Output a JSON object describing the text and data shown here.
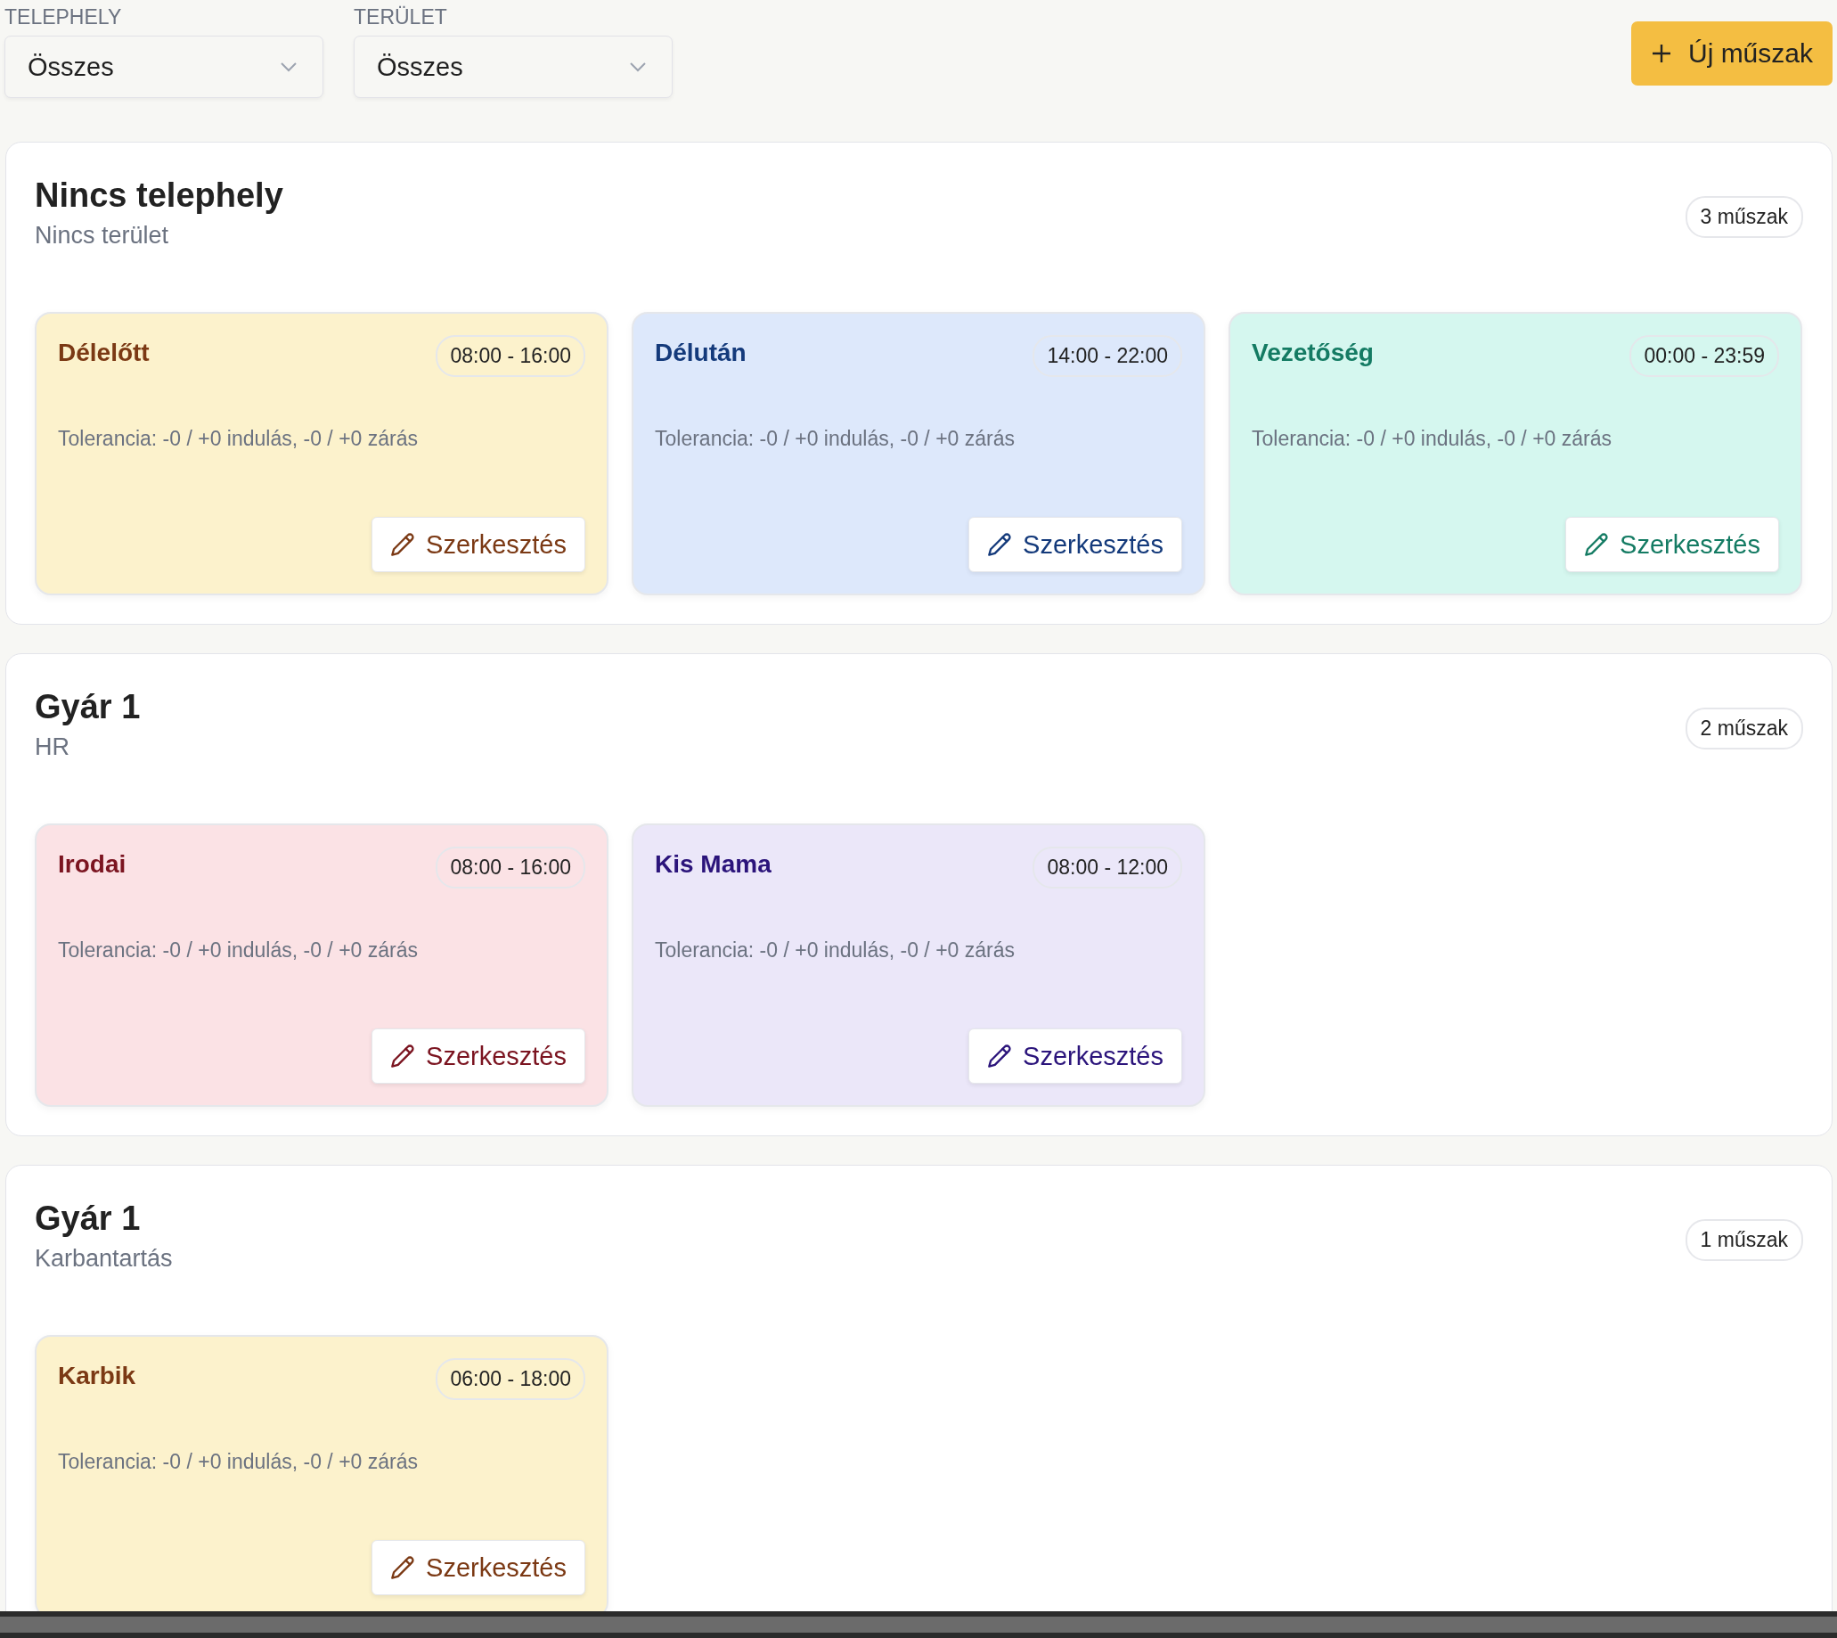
{
  "filters": [
    {
      "label": "TELEPHELY",
      "value": "Összes"
    },
    {
      "label": "TERÜLET",
      "value": "Összes"
    }
  ],
  "new_button": {
    "label": "Új műszak"
  },
  "groups": [
    {
      "site": "Nincs telephely",
      "area": "Nincs terület",
      "count": "3 műszak",
      "shifts": [
        {
          "name": "Délelőtt",
          "time": "08:00 - 16:00",
          "tolerance": "Tolerancia: -0 / +0 indulás, -0 / +0 zárás",
          "edit": "Szerkesztés",
          "color": "#fcf2cc"
        },
        {
          "name": "Délután",
          "time": "14:00 - 22:00",
          "tolerance": "Tolerancia: -0 / +0 indulás, -0 / +0 zárás",
          "edit": "Szerkesztés",
          "color": "#dde8fb"
        },
        {
          "name": "Vezetőség",
          "time": "00:00 - 23:59",
          "tolerance": "Tolerancia: -0 / +0 indulás, -0 / +0 zárás",
          "edit": "Szerkesztés",
          "color": "#d5f7ef"
        }
      ]
    },
    {
      "site": "Gyár 1",
      "area": "HR",
      "count": "2 műszak",
      "shifts": [
        {
          "name": "Irodai",
          "time": "08:00 - 16:00",
          "tolerance": "Tolerancia: -0 / +0 indulás, -0 / +0 zárás",
          "edit": "Szerkesztés",
          "color": "#fbe2e5"
        },
        {
          "name": "Kis Mama",
          "time": "08:00 - 12:00",
          "tolerance": "Tolerancia: -0 / +0 indulás, -0 / +0 zárás",
          "edit": "Szerkesztés",
          "color": "#ebe7f9"
        }
      ]
    },
    {
      "site": "Gyár 1",
      "area": "Karbantartás",
      "count": "1 műszak",
      "shifts": [
        {
          "name": "Karbik",
          "time": "06:00 - 18:00",
          "tolerance": "Tolerancia: -0 / +0 indulás, -0 / +0 zárás",
          "edit": "Szerkesztés",
          "color": "#fcf2cc"
        }
      ]
    }
  ]
}
